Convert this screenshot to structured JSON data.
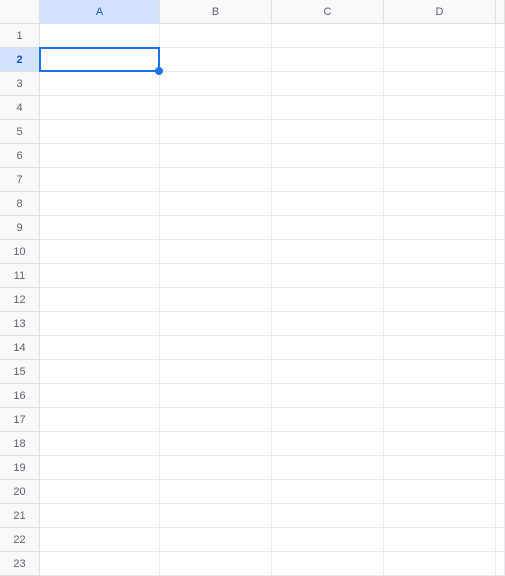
{
  "columns": [
    "A",
    "B",
    "C",
    "D",
    ""
  ],
  "rows": [
    "1",
    "2",
    "3",
    "4",
    "5",
    "6",
    "7",
    "8",
    "9",
    "10",
    "11",
    "12",
    "13",
    "14",
    "15",
    "16",
    "17",
    "18",
    "19",
    "20",
    "21",
    "22",
    "23"
  ],
  "selected_column": "A",
  "selected_row": "2",
  "colors": {
    "selection_border": "#1a73e8",
    "header_bg": "#f8f9fa",
    "header_selected_bg": "#d3e3fd"
  }
}
